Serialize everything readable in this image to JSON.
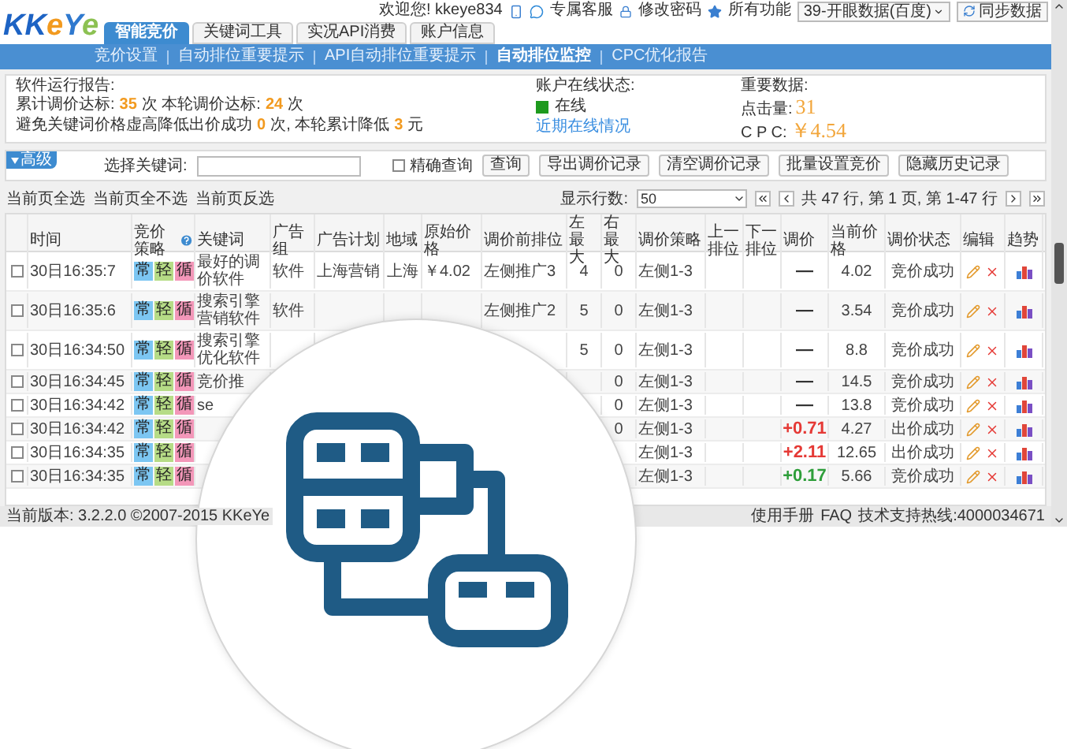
{
  "header": {
    "logo": [
      {
        "text": "KK",
        "color": "#1d63c4"
      },
      {
        "text": "e",
        "color": "#f29a1f"
      },
      {
        "text": "Y",
        "color": "#2f79cf"
      },
      {
        "text": "e",
        "color": "#8cc152"
      }
    ],
    "tabs": [
      {
        "label": "智能竞价",
        "selected": true
      },
      {
        "label": "关键词工具",
        "selected": false
      },
      {
        "label": "实况API消费",
        "selected": false
      },
      {
        "label": "账户信息",
        "selected": false
      }
    ],
    "welcome": "欢迎您! kkeye834",
    "links": [
      "专属客服",
      "修改密码",
      "所有功能"
    ],
    "account_select": "39-开眼数据(百度)",
    "sync_button": "同步数据"
  },
  "subnav": [
    {
      "label": "竞价设置",
      "selected": false
    },
    {
      "label": "自动排位重要提示",
      "selected": false
    },
    {
      "label": "API自动排位重要提示",
      "selected": false
    },
    {
      "label": "自动排位监控",
      "selected": true
    },
    {
      "label": "CPC优化报告",
      "selected": false
    }
  ],
  "report": {
    "title": "软件运行报告:",
    "lines": [
      [
        {
          "text": "累计调价达标:",
          "kind": "label"
        },
        {
          "text": "35",
          "kind": "value"
        },
        {
          "text": "次  本轮调价达标:",
          "kind": "label"
        },
        {
          "text": "24",
          "kind": "value"
        },
        {
          "text": "次",
          "kind": "label"
        }
      ],
      [
        {
          "text": "避免关键词价格虚高降低出价成功",
          "kind": "label"
        },
        {
          "text": "0",
          "kind": "value"
        },
        {
          "text": "次, 本轮累计降低",
          "kind": "label"
        },
        {
          "text": "3",
          "kind": "value"
        },
        {
          "text": "元",
          "kind": "label"
        }
      ]
    ]
  },
  "online": {
    "label": "账户在线状态:",
    "status": "在线",
    "on": true,
    "link": "近期在线情况"
  },
  "key_data": {
    "title": "重要数据:",
    "items": [
      {
        "label": "点击量:",
        "value": "31"
      },
      {
        "label": "C P C:",
        "value": "￥4.54"
      }
    ]
  },
  "filter": {
    "badge": "高级",
    "keyword_label": "选择关键词:",
    "exact": {
      "label": "精确查询",
      "checked": false
    },
    "buttons": [
      "查询",
      "导出调价记录",
      "清空调价记录",
      "批量设置竞价",
      "隐藏历史记录"
    ]
  },
  "pager": {
    "select_links": [
      "当前页全选",
      "当前页全不选",
      "当前页反选"
    ],
    "rows_label": "显示行数:",
    "rows_value": "50",
    "info": "共 47 行, 第 1 页, 第 1-47 行"
  },
  "table": {
    "columns": [
      "时间",
      "竞价策略",
      "关键词",
      "广告组",
      "广告计划",
      "地域",
      "原始价格",
      "调价前排位",
      "左最大",
      "右最大",
      "调价策略",
      "上一排位",
      "下一排位",
      "调价",
      "当前价格",
      "调价状态",
      "编辑",
      "趋势"
    ],
    "rows": [
      {
        "checked": false,
        "time": "30日16:35:7",
        "tags": [
          {
            "text": "常",
            "color": "#7cc6f2"
          },
          {
            "text": "轻",
            "color": "#b6dc86"
          },
          {
            "text": "循",
            "color": "#f397b9"
          }
        ],
        "keyword": "最好的调价软件",
        "ad_group": "软件",
        "plan": "上海营销",
        "region": "上海",
        "orig_price": "￥4.02",
        "pos_before": "左侧推广3",
        "left_max": "4",
        "right_max": "0",
        "strategy": "左侧1-3",
        "adjust": {
          "text": "—",
          "color": "#333333"
        },
        "price": "4.02",
        "status": "竞价成功"
      },
      {
        "checked": false,
        "time": "30日16:35:6",
        "tags": [
          {
            "text": "常",
            "color": "#7cc6f2"
          },
          {
            "text": "轻",
            "color": "#b6dc86"
          },
          {
            "text": "循",
            "color": "#f397b9"
          }
        ],
        "keyword": "搜索引擎营销软件",
        "ad_group": "软件",
        "pos_before": "左侧推广2",
        "left_max": "5",
        "right_max": "0",
        "strategy": "左侧1-3",
        "adjust": {
          "text": "—",
          "color": "#333333"
        },
        "price": "3.54",
        "status": "竞价成功"
      },
      {
        "checked": false,
        "time": "30日16:34:50",
        "tags": [
          {
            "text": "常",
            "color": "#7cc6f2"
          },
          {
            "text": "轻",
            "color": "#b6dc86"
          },
          {
            "text": "循",
            "color": "#f397b9"
          }
        ],
        "keyword": "搜索引擎优化软件",
        "left_max": "5",
        "right_max": "0",
        "strategy": "左侧1-3",
        "adjust": {
          "text": "—",
          "color": "#333333"
        },
        "price": "8.8",
        "status": "竞价成功"
      },
      {
        "checked": false,
        "time": "30日16:34:45",
        "tags": [
          {
            "text": "常",
            "color": "#7cc6f2"
          },
          {
            "text": "轻",
            "color": "#b6dc86"
          },
          {
            "text": "循",
            "color": "#f397b9"
          }
        ],
        "keyword": "竞价推",
        "right_max": "0",
        "strategy": "左侧1-3",
        "adjust": {
          "text": "—",
          "color": "#333333"
        },
        "price": "14.5",
        "status": "竞价成功"
      },
      {
        "checked": false,
        "time": "30日16:34:42",
        "tags": [
          {
            "text": "常",
            "color": "#7cc6f2"
          },
          {
            "text": "轻",
            "color": "#b6dc86"
          },
          {
            "text": "循",
            "color": "#f397b9"
          }
        ],
        "keyword": "se",
        "right_max": "0",
        "strategy": "左侧1-3",
        "adjust": {
          "text": "—",
          "color": "#333333"
        },
        "price": "13.8",
        "status": "竞价成功"
      },
      {
        "checked": false,
        "time": "30日16:34:42",
        "tags": [
          {
            "text": "常",
            "color": "#7cc6f2"
          },
          {
            "text": "轻",
            "color": "#b6dc86"
          },
          {
            "text": "循",
            "color": "#f397b9"
          }
        ],
        "right_max": "0",
        "strategy": "左侧1-3",
        "adjust": {
          "text": "+0.71",
          "color": "#e53935"
        },
        "price": "4.27",
        "status": "出价成功"
      },
      {
        "checked": false,
        "time": "30日16:34:35",
        "tags": [
          {
            "text": "常",
            "color": "#7cc6f2"
          },
          {
            "text": "轻",
            "color": "#b6dc86"
          },
          {
            "text": "循",
            "color": "#f397b9"
          }
        ],
        "strategy": "左侧1-3",
        "adjust": {
          "text": "+2.11",
          "color": "#e53935"
        },
        "price": "12.65",
        "status": "出价成功"
      },
      {
        "checked": false,
        "time": "30日16:34:35",
        "tags": [
          {
            "text": "常",
            "color": "#7cc6f2"
          },
          {
            "text": "轻",
            "color": "#b6dc86"
          },
          {
            "text": "循",
            "color": "#f397b9"
          }
        ],
        "strategy": "左侧1-3",
        "adjust": {
          "text": "+0.17",
          "color": "#2e9e3a"
        },
        "price": "5.66",
        "status": "竞价成功"
      }
    ]
  },
  "status_bar": {
    "version": "当前版本: 3.2.2.0 ©2007-2015 KKeYe",
    "links": [
      "使用手册",
      "FAQ"
    ],
    "hotline": "技术支持热线:4000034671"
  }
}
